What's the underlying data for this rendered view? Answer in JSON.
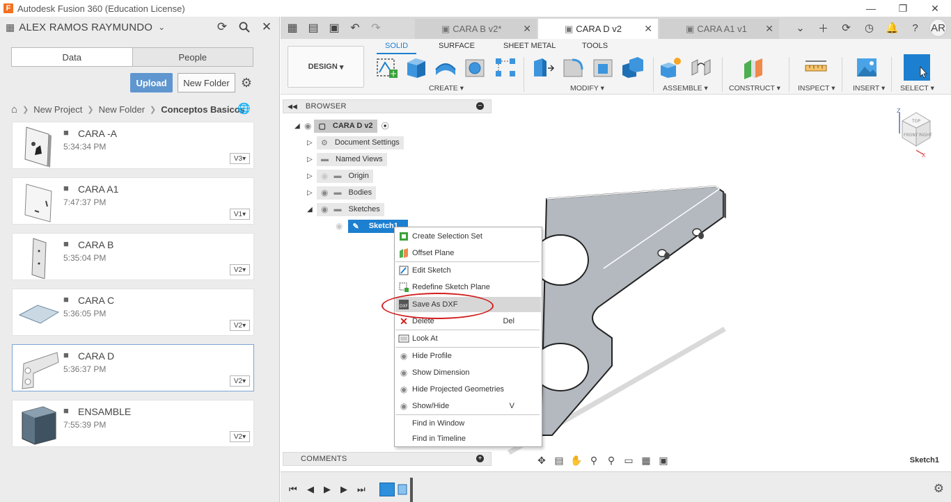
{
  "window": {
    "app_logo": "F",
    "title": "Autodesk Fusion 360 (Education License)",
    "minimize": "—",
    "restore": "❐",
    "close": "✕"
  },
  "data_panel": {
    "user": "ALEX RAMOS RAYMUNDO",
    "tabs": [
      "Data",
      "People"
    ],
    "upload_label": "Upload",
    "new_folder_label": "New Folder",
    "breadcrumb": [
      "New Project",
      "New Folder",
      "Conceptos Basicos"
    ],
    "files": [
      {
        "name": "CARA -A",
        "time": "5:34:34 PM",
        "version": "V3"
      },
      {
        "name": "CARA A1",
        "time": "7:47:37 PM",
        "version": "V1"
      },
      {
        "name": "CARA B",
        "time": "5:35:04 PM",
        "version": "V2"
      },
      {
        "name": "CARA C",
        "time": "5:36:05 PM",
        "version": "V2"
      },
      {
        "name": "CARA D",
        "time": "5:36:37 PM",
        "version": "V2"
      },
      {
        "name": "ENSAMBLE",
        "time": "7:55:39 PM",
        "version": "V2"
      }
    ]
  },
  "doc_tabs": [
    {
      "label": "CARA B v2*"
    },
    {
      "label": "CARA D v2"
    },
    {
      "label": "CARA A1 v1"
    }
  ],
  "account": {
    "initials": "AR"
  },
  "ribbon": {
    "workspace": "DESIGN",
    "tabs": [
      "SOLID",
      "SURFACE",
      "SHEET METAL",
      "TOOLS"
    ],
    "groups": [
      "CREATE",
      "MODIFY",
      "ASSEMBLE",
      "CONSTRUCT",
      "INSPECT",
      "INSERT",
      "SELECT"
    ],
    "accent": "#1c7fd0"
  },
  "browser": {
    "title": "BROWSER",
    "root": "CARA D v2",
    "nodes": [
      "Document Settings",
      "Named Views",
      "Origin",
      "Bodies",
      "Sketches"
    ],
    "sketch": "Sketch1"
  },
  "context_menu": {
    "items": [
      {
        "label": "Create Selection Set",
        "shortcut": ""
      },
      {
        "label": "Offset Plane",
        "shortcut": ""
      },
      {
        "label": "Edit Sketch",
        "shortcut": ""
      },
      {
        "label": "Redefine Sketch Plane",
        "shortcut": ""
      },
      {
        "label": "Save As DXF",
        "shortcut": ""
      },
      {
        "label": "Delete",
        "shortcut": "Del"
      },
      {
        "label": "Look At",
        "shortcut": ""
      },
      {
        "label": "Hide Profile",
        "shortcut": ""
      },
      {
        "label": "Show Dimension",
        "shortcut": ""
      },
      {
        "label": "Hide Projected Geometries",
        "shortcut": ""
      },
      {
        "label": "Show/Hide",
        "shortcut": "V"
      },
      {
        "label": "Find in Window",
        "shortcut": ""
      },
      {
        "label": "Find in Timeline",
        "shortcut": ""
      }
    ],
    "highlight_color": "#d21e1e"
  },
  "comments": {
    "title": "COMMENTS"
  },
  "status": {
    "selection": "Sketch1"
  },
  "viewcube": {
    "top": "TOP",
    "front": "FRONT",
    "right": "RIGHT",
    "z": "Z",
    "x": "X"
  }
}
